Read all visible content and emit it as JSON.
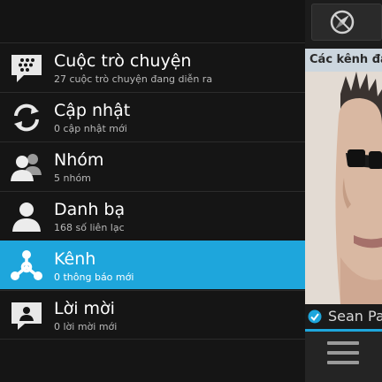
{
  "menu": {
    "items": [
      {
        "label": "Cuộc trò chuyện",
        "sub": "27 cuộc trò chuyện đang diễn ra",
        "icon": "chat-bubble-icon",
        "active": false
      },
      {
        "label": "Cập nhật",
        "sub": "0 cập nhật mới",
        "icon": "refresh-icon",
        "active": false
      },
      {
        "label": "Nhóm",
        "sub": "5 nhóm",
        "icon": "group-icon",
        "active": false
      },
      {
        "label": "Danh bạ",
        "sub": "168 số liên lạc",
        "icon": "contact-icon",
        "active": false
      },
      {
        "label": "Kênh",
        "sub": "0 thông báo mới",
        "icon": "channel-icon",
        "active": true
      },
      {
        "label": "Lời mời",
        "sub": "0 lời mời mới",
        "icon": "invite-icon",
        "active": false
      }
    ]
  },
  "right_panel": {
    "header": "Các kênh đã",
    "featured_name": "Sean Pa",
    "compass_icon": "compass-icon",
    "menu_icon": "hamburger-menu-icon"
  },
  "colors": {
    "accent": "#1ea6dc",
    "background": "#151515",
    "header_bar": "#ccd6de"
  }
}
